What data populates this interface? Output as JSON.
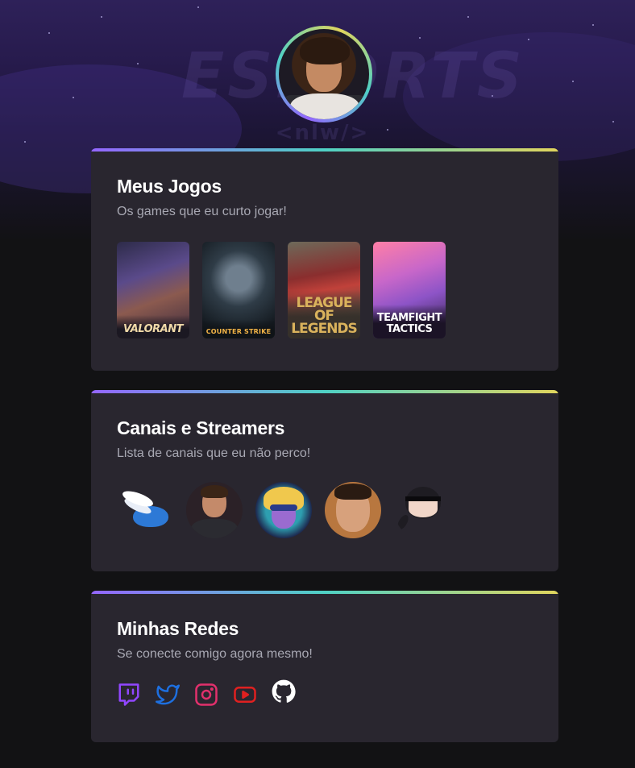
{
  "profile": {
    "avatar": "profile-photo"
  },
  "watermark": {
    "main": "ESPORTS",
    "sub": "<nlw/>"
  },
  "games_card": {
    "title": "Meus Jogos",
    "subtitle": "Os games que eu curto jogar!",
    "games": [
      {
        "name": "VALORANT",
        "accent": "#f0d9a8"
      },
      {
        "name": "COUNTER STRIKE",
        "accent": "#f3b447"
      },
      {
        "name": "LEAGUE OF LEGENDS",
        "accent": "#d9b25c"
      },
      {
        "name": "TEAMFIGHT TACTICS",
        "accent": "#ffffff"
      }
    ]
  },
  "channels_card": {
    "title": "Canais e Streamers",
    "subtitle": "Lista de canais que eu não perco!",
    "channels": [
      "winged-logo-avatar",
      "streamer-avatar-1",
      "cartoon-hero-avatar",
      "streamer-avatar-2",
      "ninja-avatar"
    ]
  },
  "networks_card": {
    "title": "Minhas Redes",
    "subtitle": "Se conecte comigo agora mesmo!",
    "networks": [
      {
        "icon": "twitch-icon",
        "color": "#9146ff"
      },
      {
        "icon": "twitter-icon",
        "color": "#1d6fe0"
      },
      {
        "icon": "instagram-icon",
        "color": "#e1306c"
      },
      {
        "icon": "youtube-icon",
        "color": "#e02020"
      },
      {
        "icon": "github-icon",
        "color": "#ffffff"
      }
    ]
  },
  "colors": {
    "background": "#121214",
    "card": "#29262f",
    "gradient": [
      "#9466ff",
      "#4fd1c5",
      "#e1d55d"
    ],
    "title": "#ffffff",
    "subtitle": "#a8a8b3"
  }
}
